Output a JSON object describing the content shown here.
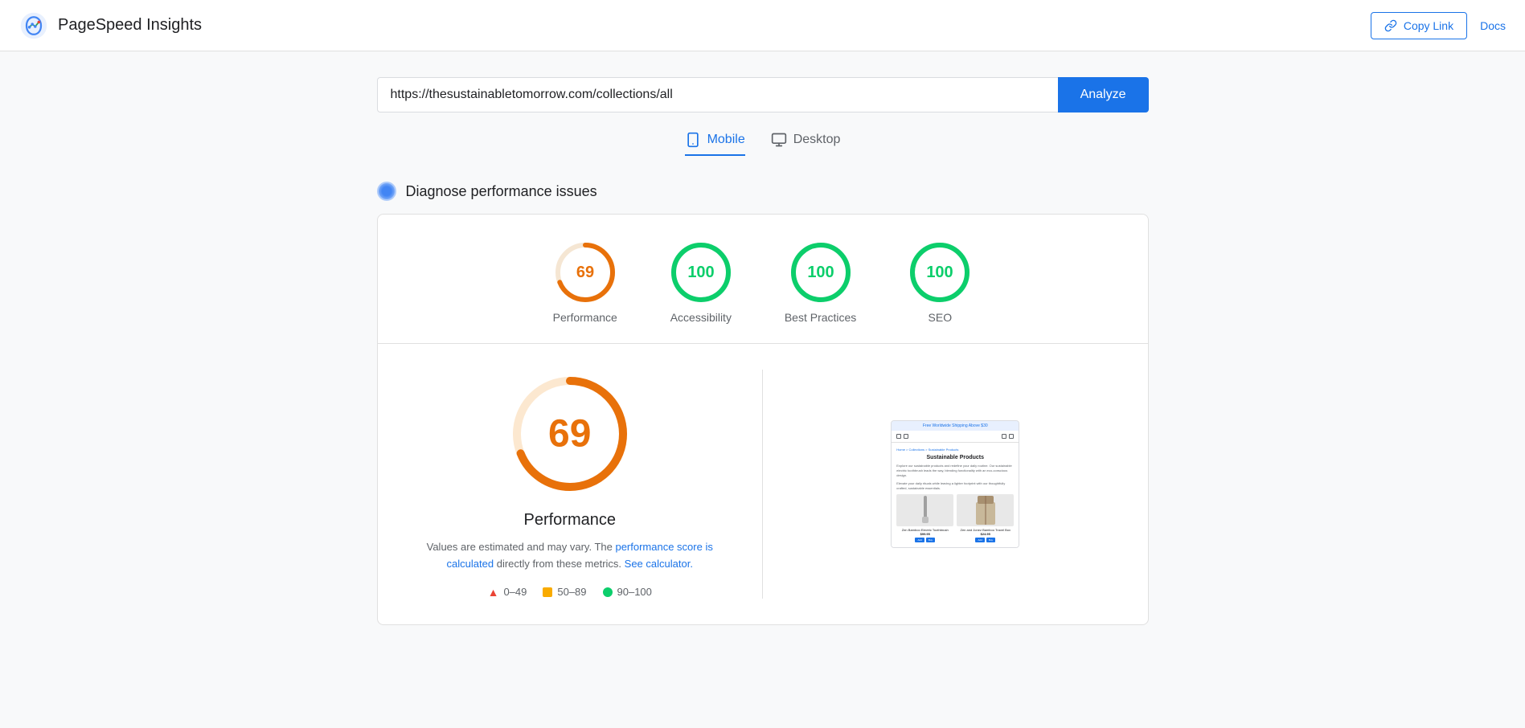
{
  "header": {
    "app_name": "PageSpeed Insights",
    "copy_link_label": "Copy Link",
    "docs_label": "Docs"
  },
  "url_bar": {
    "url_value": "https://thesustainabletomorrow.com/collections/all",
    "analyze_label": "Analyze"
  },
  "tabs": [
    {
      "id": "mobile",
      "label": "Mobile",
      "active": true
    },
    {
      "id": "desktop",
      "label": "Desktop",
      "active": false
    }
  ],
  "section": {
    "title": "Diagnose performance issues"
  },
  "scores": [
    {
      "id": "performance",
      "value": 69,
      "label": "Performance",
      "color": "#e8710a",
      "bg": "#fce8d0",
      "type": "warn"
    },
    {
      "id": "accessibility",
      "value": 100,
      "label": "Accessibility",
      "color": "#0cce6b",
      "type": "pass"
    },
    {
      "id": "best-practices",
      "value": 100,
      "label": "Best Practices",
      "color": "#0cce6b",
      "type": "pass"
    },
    {
      "id": "seo",
      "value": 100,
      "label": "SEO",
      "color": "#0cce6b",
      "type": "pass"
    }
  ],
  "detail": {
    "score": 69,
    "title": "Performance",
    "note_text": "Values are estimated and may vary. The",
    "note_link1": "performance score is calculated",
    "note_link1_suffix": "directly from these metrics.",
    "note_link2": "See calculator.",
    "legend": [
      {
        "id": "fail",
        "range": "0–49",
        "type": "fail"
      },
      {
        "id": "warn",
        "range": "50–89",
        "type": "warn"
      },
      {
        "id": "pass",
        "range": "90–100",
        "type": "pass"
      }
    ]
  },
  "preview": {
    "top_bar": "Free Worldwide Shipping Above $30",
    "breadcrumb": "Home > Collections > Sustainable Products",
    "h1": "Sustainable Products",
    "body_text1": "Explore our sustainable products and redefine your daily routine. Our sustainable electric toothbrush leads the way, blending functionality with an eco-conscious design.",
    "body_text2": "Elevate your daily rituals while leaving a lighter footprint with our thoughtfully crafted, sustainable essentials.",
    "products": [
      {
        "name": "Zen Bamboo Electric Toothbrush",
        "price": "$99.95"
      },
      {
        "name": "Zen and Jonez Bamboo Travel Box",
        "price": "$24.95"
      }
    ]
  },
  "colors": {
    "orange": "#e8710a",
    "green": "#0cce6b",
    "blue": "#1a73e8",
    "red": "#ea4335",
    "yellow": "#f9ab00"
  }
}
